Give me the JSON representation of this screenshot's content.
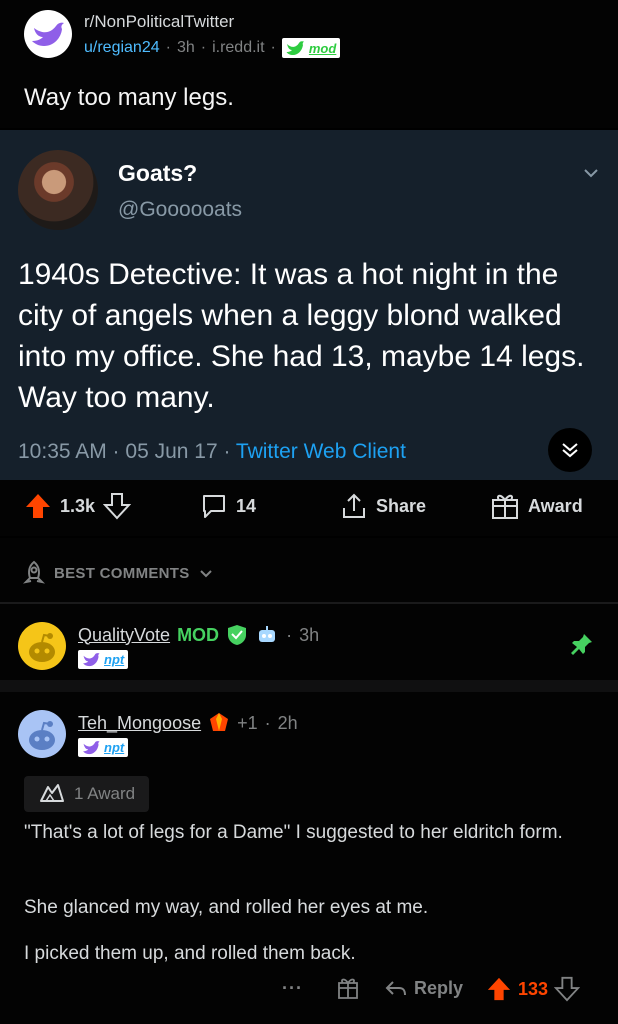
{
  "post": {
    "subreddit": "r/NonPoliticalTwitter",
    "author": "u/regian24",
    "age": "3h",
    "domain": "i.redd.it",
    "flair": "mod",
    "title": "Way too many legs."
  },
  "tweet": {
    "display_name": "Goats?",
    "handle": "@Goooooats",
    "text": "1940s Detective: It was a hot night in the city of angels when a leggy blond walked into my office. She had 13, maybe 14 legs. Way too many.",
    "time": "10:35 AM · 05 Jun 17 · ",
    "client": "Twitter Web Client"
  },
  "actions": {
    "score": "1.3k",
    "comments": "14",
    "share": "Share",
    "award": "Award"
  },
  "sort": {
    "label": "BEST COMMENTS"
  },
  "comments": [
    {
      "author": "QualityVote",
      "mod_label": "MOD",
      "age": "3h",
      "flair": "npt"
    },
    {
      "author": "Teh_Mongoose",
      "karma": "+1",
      "age": "2h",
      "flair": "npt",
      "award_label": "1 Award",
      "paragraphs": [
        "\"That's a lot of legs for a Dame\" I suggested to her eldritch form.",
        "She glanced my way, and rolled her eyes at me.",
        "I picked them up, and rolled them back."
      ],
      "more": "···",
      "reply": "Reply",
      "score": "133"
    }
  ],
  "colors": {
    "upvote": "#ff4500",
    "mod_green": "#46d160",
    "link_blue": "#4fbcff",
    "twitter_blue": "#1da1f2",
    "tweet_bg": "#15202b"
  }
}
